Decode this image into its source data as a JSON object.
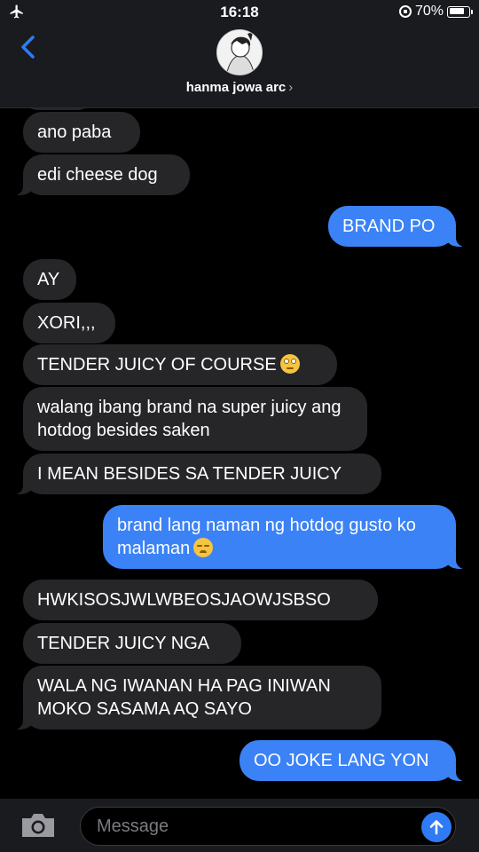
{
  "status_bar": {
    "time": "16:18",
    "battery": "70%"
  },
  "header": {
    "contact_name": "hanma jowa arc",
    "chevron": "›"
  },
  "messages": [
    {
      "from": "them",
      "text": "ano paba"
    },
    {
      "from": "them",
      "text": "edi cheese dog"
    },
    {
      "from": "me",
      "text": "BRAND PO"
    },
    {
      "from": "them",
      "text": "AY"
    },
    {
      "from": "them",
      "text": "XORI,,,"
    },
    {
      "from": "them",
      "text": "TENDER JUICY OF COURSE",
      "emoji": "face-with-rolling-eyes"
    },
    {
      "from": "them",
      "text": "walang ibang brand na super juicy ang hotdog besides saken"
    },
    {
      "from": "them",
      "text": "I MEAN BESIDES SA TENDER JUICY"
    },
    {
      "from": "me",
      "text": "brand lang naman ng hotdog gusto ko malaman",
      "emoji": "disappointed-face"
    },
    {
      "from": "them",
      "text": "HWKISOSJWLWBEOSJAOWJSBSO"
    },
    {
      "from": "them",
      "text": "TENDER JUICY NGA"
    },
    {
      "from": "them",
      "text": "WALA NG IWANAN HA PAG INIWAN MOKO SASAMA AQ SAYO"
    },
    {
      "from": "me",
      "text": "OO JOKE LANG YON"
    }
  ],
  "composer": {
    "placeholder": "Message"
  },
  "colors": {
    "incoming": "#262628",
    "outgoing": "#3b82f6",
    "background": "#000000",
    "header": "#1a1b1f"
  },
  "icons": [
    "airplane-icon",
    "location-lock-icon",
    "battery-icon",
    "back-chevron-icon",
    "camera-icon",
    "send-arrow-icon"
  ]
}
